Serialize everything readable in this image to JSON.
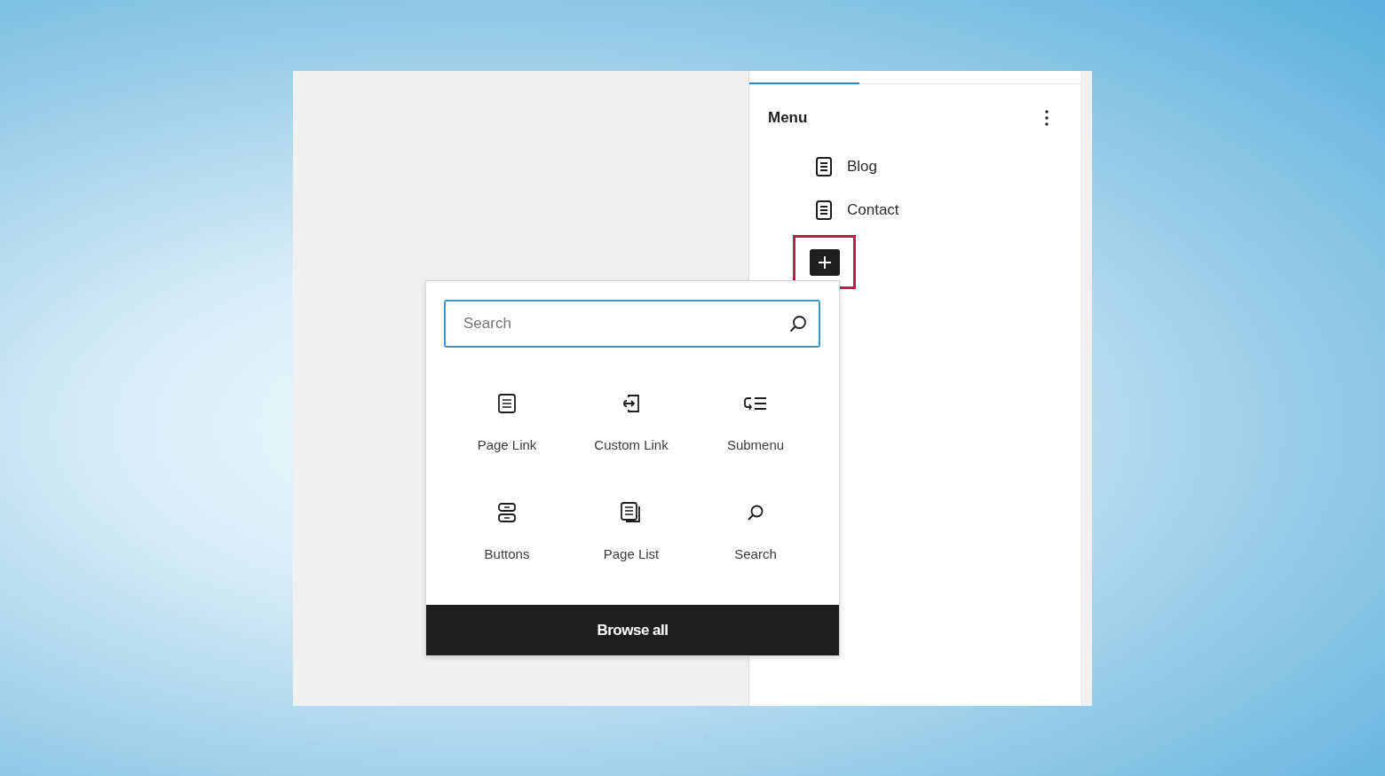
{
  "sidebar": {
    "tabs": [
      {
        "selected": true
      },
      {
        "selected": false
      }
    ],
    "title": "Menu",
    "items": [
      {
        "label": "Blog",
        "kind": "page"
      },
      {
        "label": "Contact",
        "kind": "page"
      }
    ],
    "add_button": {
      "highlighted": true
    }
  },
  "inserter": {
    "search": {
      "placeholder": "Search"
    },
    "blocks": [
      {
        "label": "Page Link",
        "kind": "page-link"
      },
      {
        "label": "Custom Link",
        "kind": "custom-link"
      },
      {
        "label": "Submenu",
        "kind": "submenu"
      },
      {
        "label": "Buttons",
        "kind": "buttons"
      },
      {
        "label": "Page List",
        "kind": "page-list"
      },
      {
        "label": "Search",
        "kind": "search"
      }
    ],
    "browse_button": "Browse all"
  }
}
